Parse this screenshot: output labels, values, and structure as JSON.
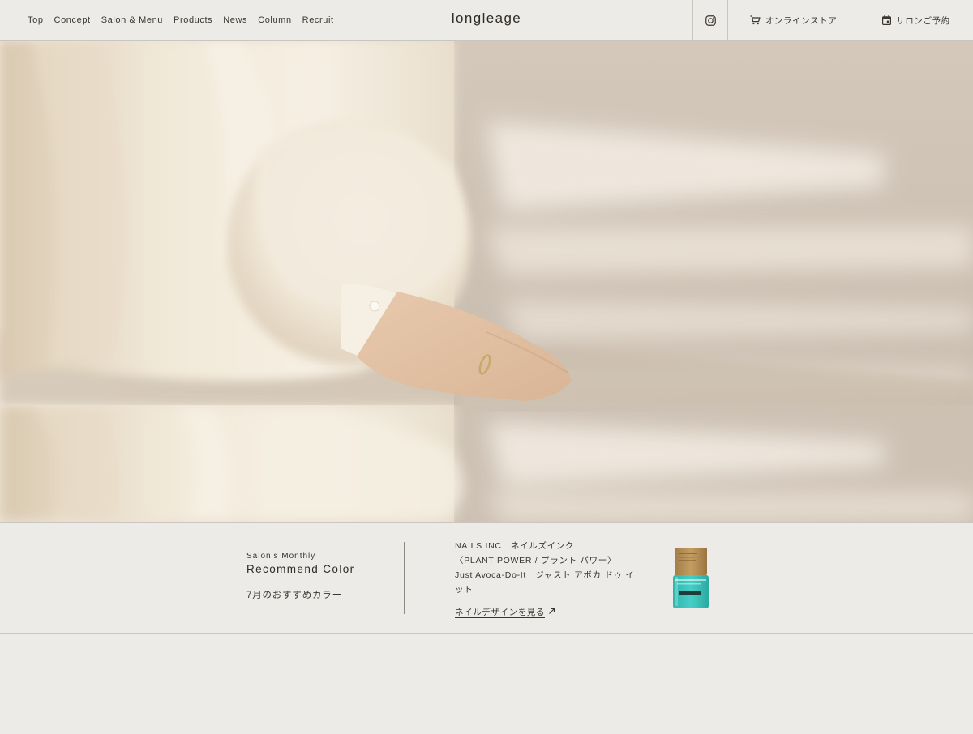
{
  "nav": {
    "items": [
      "Top",
      "Concept",
      "Salon & Menu",
      "Products",
      "News",
      "Column",
      "Recruit"
    ]
  },
  "brand": {
    "logo": "longleage"
  },
  "header_actions": {
    "instagram_icon": "instagram-icon",
    "online_store": "オンラインストア",
    "salon_reserve": "サロンご予約"
  },
  "recommend": {
    "eyebrow": "Salon's Monthly",
    "title": "Recommend Color",
    "month_label": "7月のおすすめカラー",
    "brand_line": "NAILS INC　ネイルズインク",
    "collection_line": "〈PLANT POWER / プラント パワー〉",
    "color_line": "Just Avoca-Do-It　ジャスト アボカ ドゥ イット",
    "link_label": "ネイルデザインを見る"
  },
  "colors": {
    "background": "#edebe7",
    "border": "#c9c5bf",
    "text": "#3a3631",
    "bottle_teal": "#35c3bb",
    "bottle_cap": "#b08a4f"
  }
}
